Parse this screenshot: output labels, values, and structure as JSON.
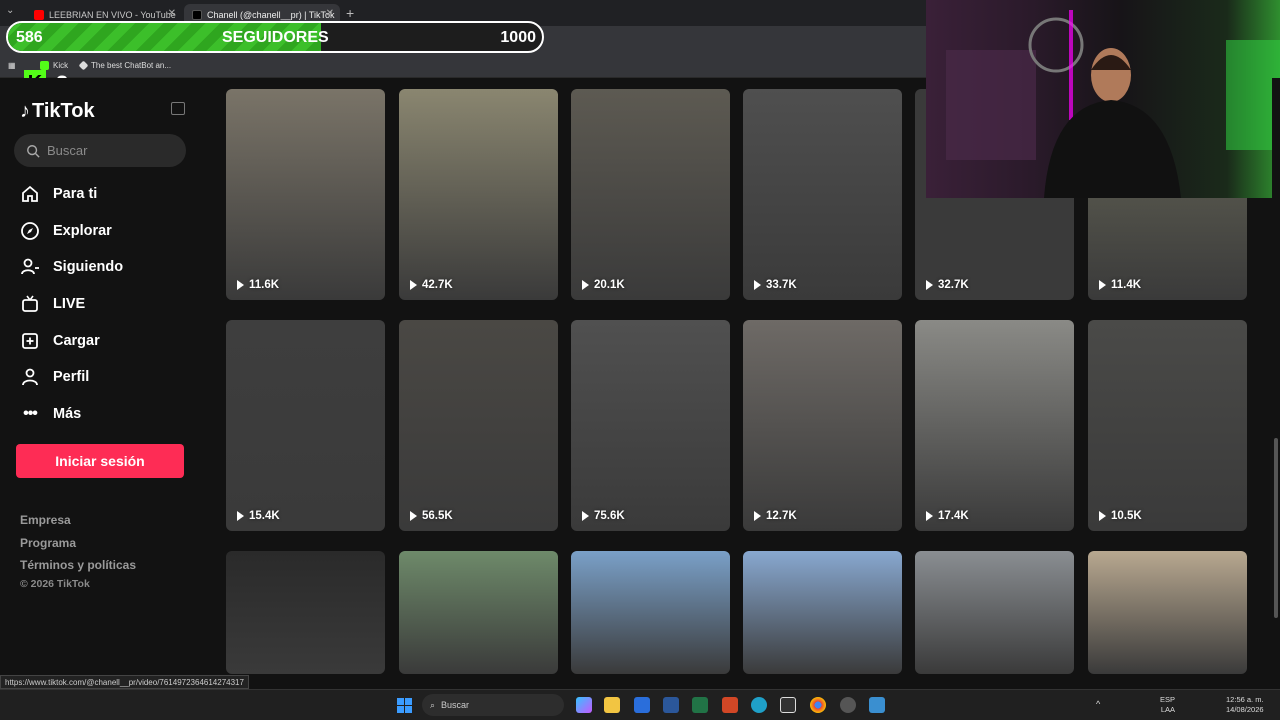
{
  "browser": {
    "tabs": [
      {
        "label": "LEEBRIAN EN VIVO - YouTube",
        "active": false
      },
      {
        "label": "Chanell (@chanell__pr) | TikTok",
        "active": true
      }
    ],
    "bookmarks": [
      {
        "label": "Kick"
      },
      {
        "label": "The best ChatBot an..."
      }
    ],
    "status_url": "https://www.tiktok.com/@chanell__pr/video/7614972364614274317"
  },
  "overlay": {
    "goal_current": "586",
    "goal_label": "SEGUIDORES",
    "goal_target": "1000",
    "goal_progress": 0.586,
    "kick_count": "3"
  },
  "sidebar": {
    "logo": "TikTok",
    "search_placeholder": "Buscar",
    "nav": [
      {
        "label": "Para ti",
        "icon": "home-icon"
      },
      {
        "label": "Explorar",
        "icon": "compass-icon"
      },
      {
        "label": "Siguiendo",
        "icon": "user-follow-icon"
      },
      {
        "label": "LIVE",
        "icon": "tv-icon"
      },
      {
        "label": "Cargar",
        "icon": "upload-icon"
      },
      {
        "label": "Perfil",
        "icon": "profile-icon"
      },
      {
        "label": "Más",
        "icon": "more-icon"
      }
    ],
    "login_button": "Iniciar sesión",
    "footer": [
      "Empresa",
      "Programa",
      "Términos y políticas"
    ],
    "copyright": "© 2026 TikTok"
  },
  "videos": [
    {
      "views": "11.6K",
      "color": "#7a7468"
    },
    {
      "views": "42.7K",
      "color": "#8a8670"
    },
    {
      "views": "20.1K",
      "color": "#5d5a52"
    },
    {
      "views": "33.7K",
      "color": "#4f4f4f"
    },
    {
      "views": "32.7K",
      "color": "#3a3a3a"
    },
    {
      "views": "11.4K",
      "color": "#6a6a5a"
    },
    {
      "views": "15.4K",
      "color": "#3e3e3e"
    },
    {
      "views": "56.5K",
      "color": "#4a4844"
    },
    {
      "views": "75.6K",
      "color": "#505050"
    },
    {
      "views": "12.7K",
      "color": "#6e6a66"
    },
    {
      "views": "17.4K",
      "color": "#8a8a86"
    },
    {
      "views": "10.5K",
      "color": "#4a4a48"
    },
    {
      "views": "",
      "color": "#2a2a2a"
    },
    {
      "views": "",
      "color": "#6e8a6a"
    },
    {
      "views": "",
      "color": "#7aa0c8"
    },
    {
      "views": "",
      "color": "#88a8d0"
    },
    {
      "views": "",
      "color": "#8a8e92"
    },
    {
      "views": "",
      "color": "#b8a890"
    }
  ],
  "taskbar": {
    "search_placeholder": "Buscar",
    "lang": "ESP",
    "lang2": "LAA",
    "time": "12:56 a. m.",
    "date": "14/08/2026"
  }
}
